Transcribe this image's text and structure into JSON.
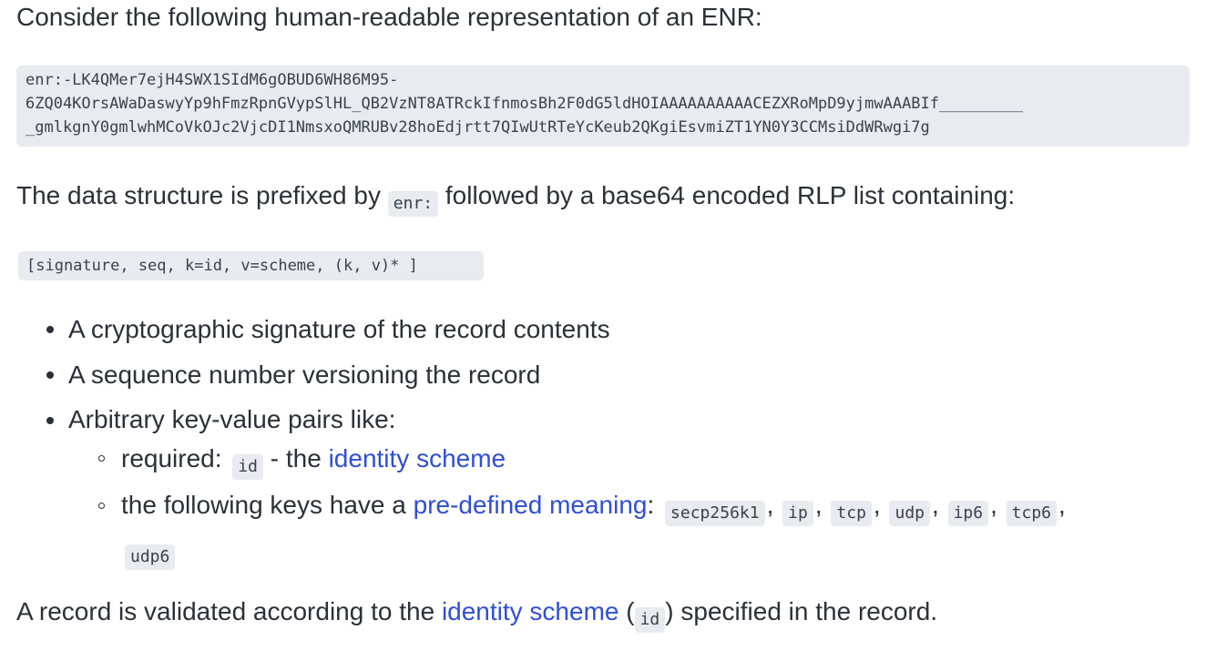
{
  "intro": {
    "text": "Consider the following human-readable representation of an ENR:"
  },
  "enr_example": {
    "lines": [
      "enr:-LK4QMer7ejH4SWX1SIdM6gOBUD6WH86M95-",
      "6ZQ04KOrsAWaDaswyYp9hFmzRpnGVypSlHL_QB2VzNT8ATRckIfnmosBh2F0dG5ldHOIAAAAAAAAAACEZXRoMpD9yjmwAAABIf_________",
      "_gmlkgnY0gmlwhMCoVkOJc2VjcDI1NmsxoQMRUBv28hoEdjrtt7QIwUtRTeYcKeub2QKgiEsvmiZT1YN0Y3CCMsiDdWRwgi7g"
    ]
  },
  "structure": {
    "before": "The data structure is prefixed by",
    "code": "enr:",
    "after": "followed by a base64 encoded RLP list containing:",
    "list_code": "[signature, seq, k=id, v=scheme, (k, v)* ]"
  },
  "bullets": {
    "signature": "A cryptographic signature of the record contents",
    "sequence": "A sequence number versioning the record",
    "pairs": "Arbitrary key-value pairs like:"
  },
  "sub_required": {
    "label": "required:",
    "code": "id",
    "dash": "- the",
    "link": "identity scheme"
  },
  "sub_predefined": {
    "before": "the following keys have a",
    "link": "pre-defined meaning",
    "colon": ":",
    "keys": [
      "secp256k1",
      "ip",
      "tcp",
      "udp",
      "ip6",
      "tcp6",
      "udp6"
    ],
    "comma": ","
  },
  "validation": {
    "before": "A record is validated according to the",
    "link": "identity scheme",
    "open": "(",
    "code": "id",
    "after": ") specified in the record."
  },
  "colors": {
    "text": "#2b3139",
    "link": "#2f4fd3",
    "code_bg": "#e8ebef"
  }
}
